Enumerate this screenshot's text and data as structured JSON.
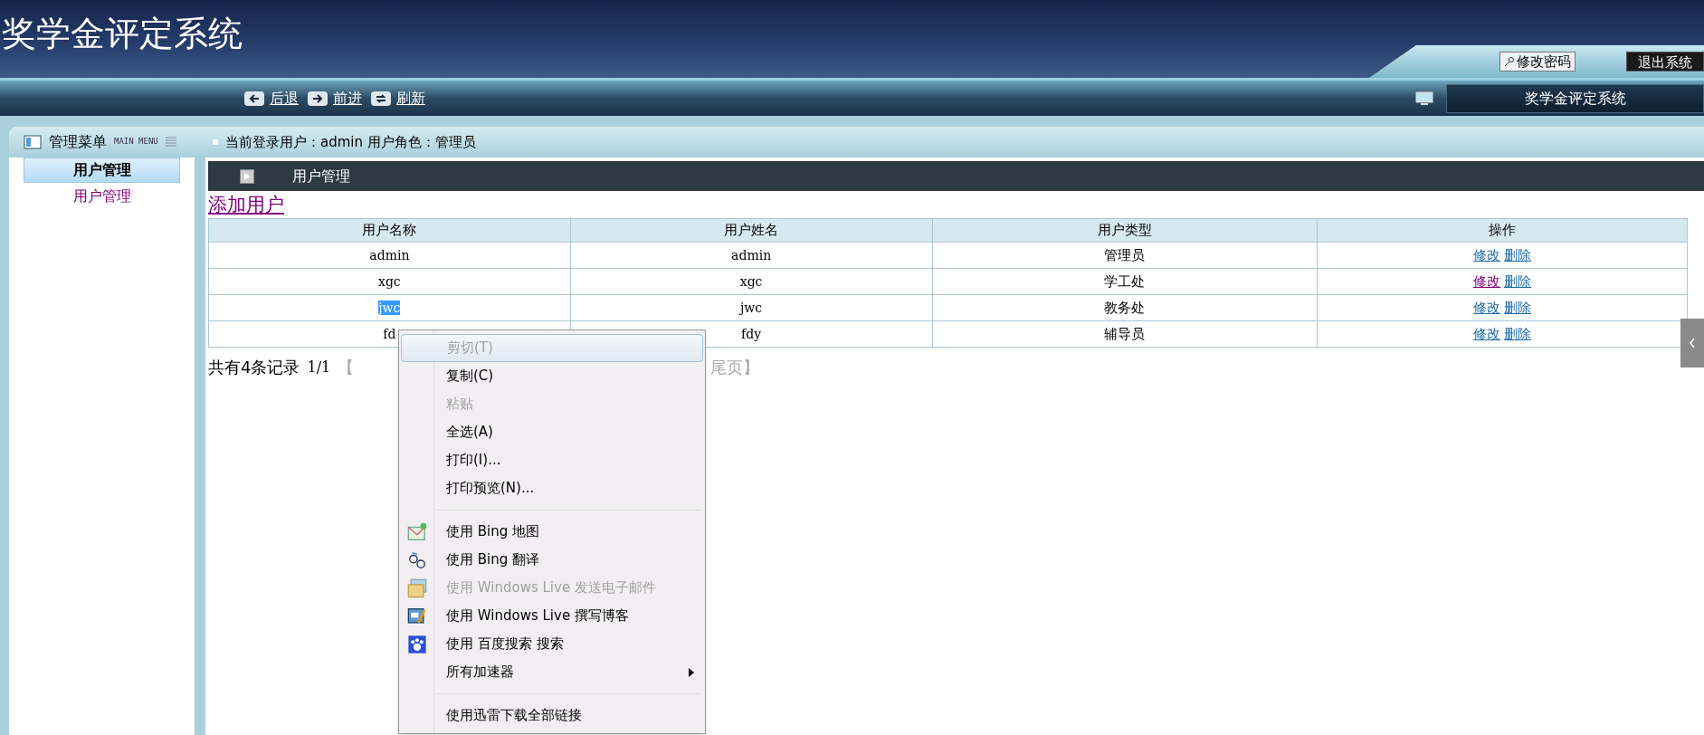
{
  "header": {
    "title": "奖学金评定系统",
    "buttons": [
      {
        "label": "修改密码",
        "kind": "key"
      },
      {
        "label": "退出系统",
        "kind": "dark"
      }
    ]
  },
  "nav": {
    "buttons": [
      {
        "label": "后退",
        "kind": "back"
      },
      {
        "label": "前进",
        "kind": "forward"
      },
      {
        "label": "刷新",
        "kind": "refresh"
      }
    ],
    "system_label": "奖学金评定系统"
  },
  "sidebar": {
    "title": "管理菜单",
    "subtitle": "MAIN MENU",
    "groups": [
      {
        "label": "用户管理",
        "selected": true,
        "children": [
          {
            "label": "用户管理"
          }
        ]
      }
    ]
  },
  "user_info": "当前登录用户：admin 用户角色：管理员",
  "section_title": "用户管理",
  "add_link": "添加用户",
  "table": {
    "columns": [
      "用户名称",
      "用户姓名",
      "用户类型",
      "操作"
    ],
    "rows": [
      {
        "cells": [
          "admin",
          "admin",
          "管理员"
        ],
        "name_highlighted": false,
        "actions": [
          {
            "label": "修改",
            "visited": false
          },
          {
            "label": "删除",
            "visited": false
          }
        ]
      },
      {
        "cells": [
          "xgc",
          "xgc",
          "学工处"
        ],
        "name_highlighted": false,
        "actions": [
          {
            "label": "修改",
            "visited": true
          },
          {
            "label": "删除",
            "visited": false
          }
        ]
      },
      {
        "cells": [
          "jwc",
          "jwc",
          "教务处"
        ],
        "name_highlighted": true,
        "actions": [
          {
            "label": "修改",
            "visited": false
          },
          {
            "label": "删除",
            "visited": false
          }
        ]
      },
      {
        "cells": [
          "fd",
          "fdy",
          "辅导员"
        ],
        "name_highlighted": false,
        "actions": [
          {
            "label": "修改",
            "visited": false
          },
          {
            "label": "删除",
            "visited": false
          }
        ]
      }
    ]
  },
  "pager": {
    "count": "共有4条记录",
    "page": "1/1",
    "left": "【",
    "right": "尾页】"
  },
  "context_menu": [
    {
      "kind": "item",
      "label": "剪切(T)",
      "disabled": true,
      "hovered": true
    },
    {
      "kind": "item",
      "label": "复制(C)",
      "disabled": false,
      "hovered": false
    },
    {
      "kind": "item",
      "label": "粘贴",
      "disabled": true,
      "hovered": false
    },
    {
      "kind": "item",
      "label": "全选(A)",
      "disabled": false,
      "hovered": false
    },
    {
      "kind": "item",
      "label": "打印(I)...",
      "disabled": false,
      "hovered": false
    },
    {
      "kind": "item",
      "label": "打印预览(N)...",
      "disabled": false,
      "hovered": false
    },
    {
      "kind": "separator"
    },
    {
      "kind": "item",
      "label": "使用 Bing 地图",
      "disabled": false,
      "hovered": false,
      "has_icon": true
    },
    {
      "kind": "item",
      "label": "使用 Bing 翻译",
      "disabled": false,
      "hovered": false,
      "has_icon": true
    },
    {
      "kind": "item",
      "label": "使用 Windows Live 发送电子邮件",
      "disabled": true,
      "hovered": false,
      "has_icon": true
    },
    {
      "kind": "item",
      "label": "使用 Windows Live 撰写博客",
      "disabled": false,
      "hovered": false,
      "has_icon": true
    },
    {
      "kind": "item",
      "label": "使用 百度搜索 搜索",
      "disabled": false,
      "hovered": false,
      "has_icon": true
    },
    {
      "kind": "item",
      "label": "所有加速器",
      "disabled": false,
      "hovered": false,
      "submenu": true
    },
    {
      "kind": "separator"
    },
    {
      "kind": "item",
      "label": "使用迅雷下载全部链接",
      "disabled": false,
      "hovered": false
    }
  ]
}
